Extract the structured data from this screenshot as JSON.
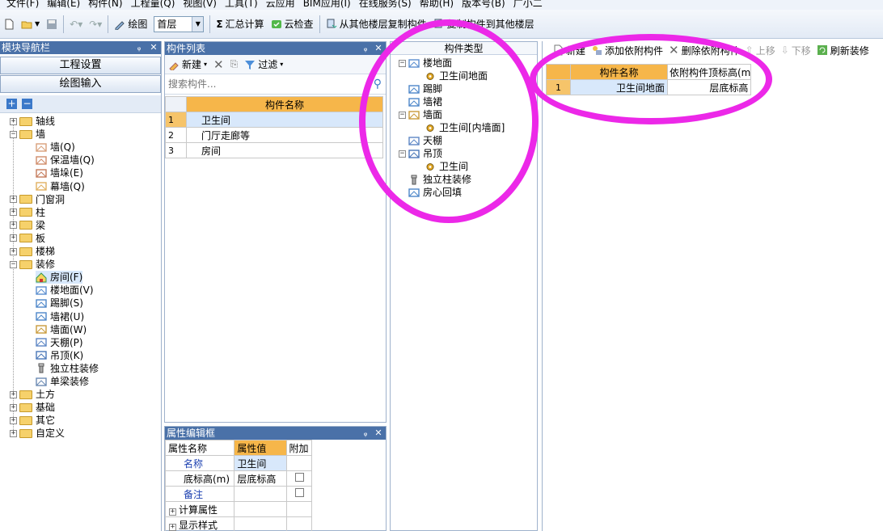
{
  "menu": [
    "文件(F)",
    "编辑(E)",
    "构件(N)",
    "工程量(Q)",
    "视图(V)",
    "工具(T)",
    "云应用",
    "BIM应用(I)",
    "在线服务(S)",
    "帮助(H)",
    "版本号(B)",
    "广小二"
  ],
  "toolbar": {
    "draw_label": "绘图",
    "floor": "首层",
    "sum_calc": "汇总计算",
    "cloud_check": "云检查",
    "copy_from": "从其他楼层复制构件",
    "copy_to": "复制构件到其他楼层"
  },
  "nav": {
    "title": "模块导航栏",
    "project_settings": "工程设置",
    "drawing_input": "绘图输入",
    "tree": [
      {
        "label": "轴线",
        "level": 0,
        "folder": true,
        "pm": "+"
      },
      {
        "label": "墙",
        "level": 0,
        "folder": true,
        "pm": "-"
      },
      {
        "label": "墙(Q)",
        "level": 1,
        "icon": "wall-icon"
      },
      {
        "label": "保温墙(Q)",
        "level": 1,
        "icon": "insulation-wall-icon"
      },
      {
        "label": "墙垛(E)",
        "level": 1,
        "icon": "wall-pier-icon"
      },
      {
        "label": "幕墙(Q)",
        "level": 1,
        "icon": "curtain-wall-icon"
      },
      {
        "label": "门窗洞",
        "level": 0,
        "folder": true,
        "pm": "+"
      },
      {
        "label": "柱",
        "level": 0,
        "folder": true,
        "pm": "+"
      },
      {
        "label": "梁",
        "level": 0,
        "folder": true,
        "pm": "+"
      },
      {
        "label": "板",
        "level": 0,
        "folder": true,
        "pm": "+"
      },
      {
        "label": "楼梯",
        "level": 0,
        "folder": true,
        "pm": "+"
      },
      {
        "label": "装修",
        "level": 0,
        "folder": true,
        "pm": "-"
      },
      {
        "label": "房间(F)",
        "level": 1,
        "icon": "room-icon",
        "selected": true
      },
      {
        "label": "楼地面(V)",
        "level": 1,
        "icon": "floor-icon"
      },
      {
        "label": "踢脚(S)",
        "level": 1,
        "icon": "skirting-icon"
      },
      {
        "label": "墙裙(U)",
        "level": 1,
        "icon": "dado-icon"
      },
      {
        "label": "墙面(W)",
        "level": 1,
        "icon": "wall-surface-icon"
      },
      {
        "label": "天棚(P)",
        "level": 1,
        "icon": "ceiling-icon"
      },
      {
        "label": "吊顶(K)",
        "level": 1,
        "icon": "suspended-ceiling-icon"
      },
      {
        "label": "独立柱装修",
        "level": 1,
        "icon": "column-decoration-icon"
      },
      {
        "label": "单梁装修",
        "level": 1,
        "icon": "beam-decoration-icon"
      },
      {
        "label": "土方",
        "level": 0,
        "folder": true,
        "pm": "+"
      },
      {
        "label": "基础",
        "level": 0,
        "folder": true,
        "pm": "+"
      },
      {
        "label": "其它",
        "level": 0,
        "folder": true,
        "pm": "+"
      },
      {
        "label": "自定义",
        "level": 0,
        "folder": true,
        "pm": "+"
      }
    ]
  },
  "complist": {
    "title": "构件列表",
    "new_label": "新建",
    "filter_label": "过滤",
    "search_placeholder": "搜索构件...",
    "header": "构件名称",
    "rows": [
      {
        "n": "1",
        "name": "卫生间"
      },
      {
        "n": "2",
        "name": "门厅走廊等"
      },
      {
        "n": "3",
        "name": "房间"
      }
    ]
  },
  "types": {
    "title": "构件类型",
    "tree": [
      {
        "label": "楼地面",
        "level": 0,
        "pm": "-",
        "icon": "floor-icon"
      },
      {
        "label": "卫生间地面",
        "level": 1,
        "icon": "gear-icon"
      },
      {
        "label": "踢脚",
        "level": 0,
        "icon": "skirting-icon"
      },
      {
        "label": "墙裙",
        "level": 0,
        "icon": "dado-icon"
      },
      {
        "label": "墙面",
        "level": 0,
        "pm": "-",
        "icon": "wall-surface-icon"
      },
      {
        "label": "卫生间[内墙面]",
        "level": 1,
        "icon": "gear-icon"
      },
      {
        "label": "天棚",
        "level": 0,
        "icon": "ceiling-icon"
      },
      {
        "label": "吊顶",
        "level": 0,
        "pm": "-",
        "icon": "suspended-ceiling-icon"
      },
      {
        "label": "卫生间",
        "level": 1,
        "icon": "gear-icon"
      },
      {
        "label": "独立柱装修",
        "level": 0,
        "icon": "column-decoration-icon"
      },
      {
        "label": "房心回填",
        "level": 0,
        "icon": "backfill-icon"
      }
    ]
  },
  "dep": {
    "new_label": "新建",
    "add_label": "添加依附构件",
    "delete_label": "删除依附构件",
    "up_label": "上移",
    "down_label": "下移",
    "refresh_label": "刷新装修",
    "headers": [
      "构件名称",
      "依附构件顶标高(m"
    ],
    "rows": [
      {
        "n": "1",
        "name": "卫生间地面",
        "elev": "层底标高"
      }
    ]
  },
  "props": {
    "title": "属性编辑框",
    "headers": [
      "属性名称",
      "属性值",
      "附加"
    ],
    "rows": [
      {
        "name": "名称",
        "value": "卫生间",
        "check": false,
        "blue": true
      },
      {
        "name": "底标高(m)",
        "value": "层底标高",
        "check": true,
        "blue": false
      },
      {
        "name": "备注",
        "value": "",
        "check": true,
        "blue": true
      },
      {
        "name": "计算属性",
        "value": "",
        "check": false,
        "blue": false,
        "expand": "+"
      },
      {
        "name": "显示样式",
        "value": "",
        "check": false,
        "blue": false,
        "expand": "+"
      }
    ]
  },
  "colors": {
    "title_bar": "#4a71a8",
    "header_orange": "#f6b64a",
    "highlight": "#ec28e8",
    "selected_row": "#d8e8fb"
  }
}
